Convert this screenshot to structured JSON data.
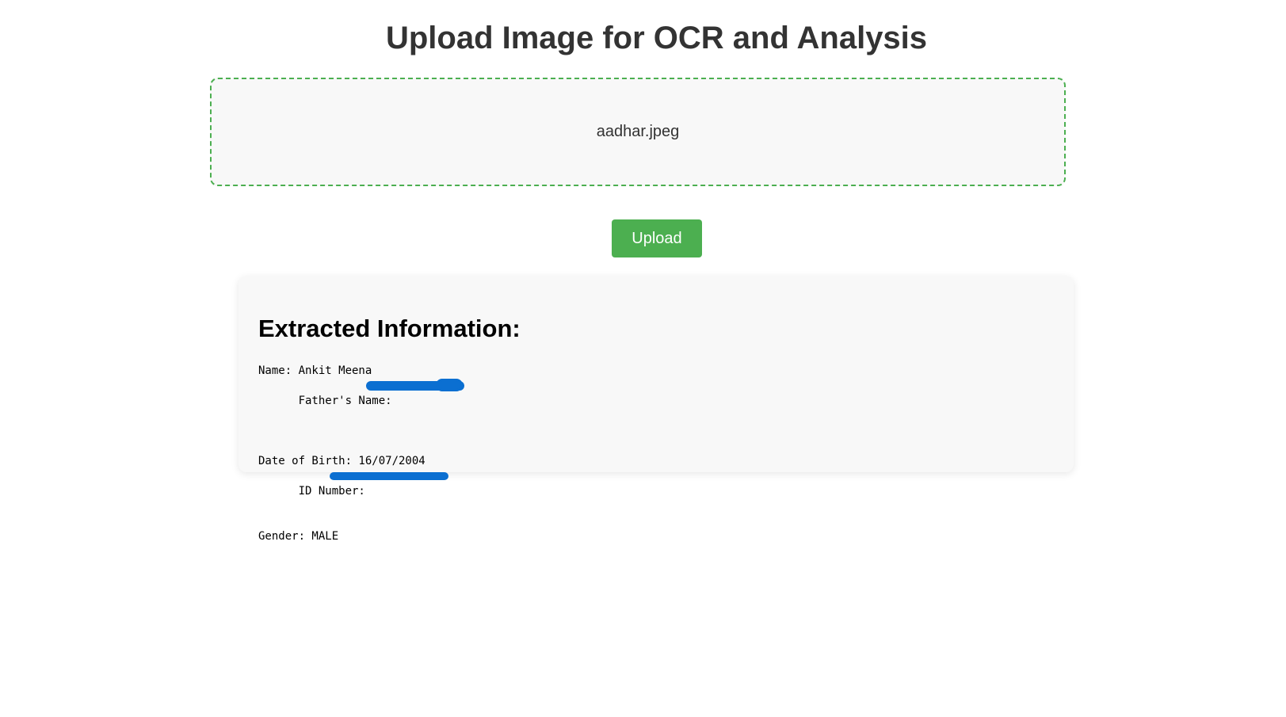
{
  "header": {
    "title": "Upload Image for OCR and Analysis"
  },
  "upload": {
    "selected_file": "aadhar.jpeg",
    "button_label": "Upload"
  },
  "colors": {
    "accent": "#4caf50",
    "redaction": "#0b6fd1"
  },
  "result": {
    "heading": "Extracted Information:",
    "lines": {
      "name": "Name: Ankit Meena",
      "father": "Father's Name: ",
      "dob": "Date of Birth: 16/07/2004",
      "id": "ID Number:",
      "gender": "Gender: MALE"
    }
  }
}
